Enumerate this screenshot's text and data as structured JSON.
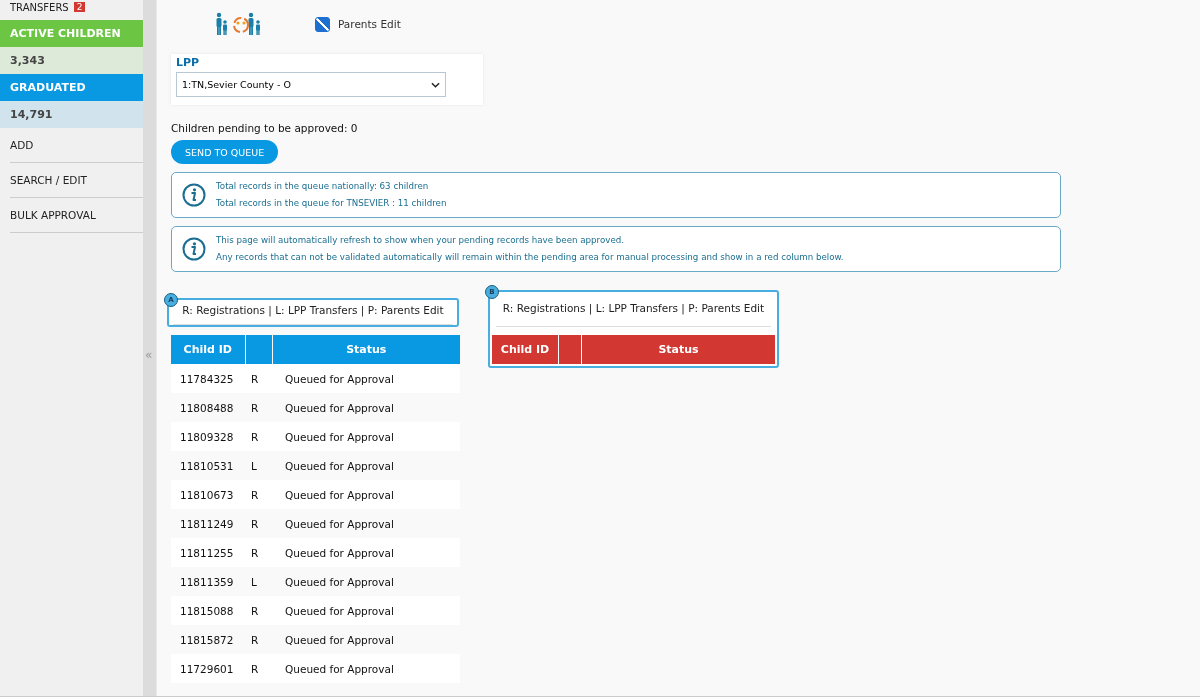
{
  "sidebar": {
    "top_item": {
      "label": "TRANSFERS",
      "badge": "2"
    },
    "stats": [
      {
        "label": "ACTIVE CHILDREN",
        "value": "3,343",
        "color": "#6cc644"
      },
      {
        "label": "GRADUATED",
        "value": "14,791",
        "color": "#0999e3"
      }
    ],
    "items": [
      "ADD",
      "SEARCH / EDIT",
      "BULK APPROVAL"
    ],
    "collapse": "«"
  },
  "filter": {
    "label": "Parents Edit",
    "checked": true
  },
  "lpp": {
    "label": "LPP",
    "value": "1:TN,Sevier County - O"
  },
  "pending": "Children pending to be approved: 0",
  "send_button": "SEND TO QUEUE",
  "info_boxes": [
    {
      "lines": [
        "Total records in the queue nationally:  63  children",
        "Total records in the queue for TNSEVIER : 11 children"
      ]
    },
    {
      "lines": [
        "This page will automatically refresh to show when your pending records have been approved.",
        "Any records that can not be validated automatically will remain within the pending area for manual processing and show in a red column below."
      ]
    }
  ],
  "tables": [
    {
      "badge": "A",
      "legend": "R: Registrations | L: LPP Transfers | P: Parents Edit",
      "color": "#0999e3",
      "columns": [
        "Child ID",
        "",
        "Status"
      ],
      "rows": [
        [
          "11784325",
          "R",
          "Queued for Approval"
        ],
        [
          "11808488",
          "R",
          "Queued for Approval"
        ],
        [
          "11809328",
          "R",
          "Queued for Approval"
        ],
        [
          "11810531",
          "L",
          "Queued for Approval"
        ],
        [
          "11810673",
          "R",
          "Queued for Approval"
        ],
        [
          "11811249",
          "R",
          "Queued for Approval"
        ],
        [
          "11811255",
          "R",
          "Queued for Approval"
        ],
        [
          "11811359",
          "L",
          "Queued for Approval"
        ],
        [
          "11815088",
          "R",
          "Queued for Approval"
        ],
        [
          "11815872",
          "R",
          "Queued for Approval"
        ],
        [
          "11729601",
          "R",
          "Queued for Approval"
        ]
      ]
    },
    {
      "badge": "B",
      "legend": "R: Registrations | L: LPP Transfers | P: Parents Edit",
      "color": "#d23732",
      "columns": [
        "Child ID",
        "",
        "Status"
      ]
    }
  ]
}
